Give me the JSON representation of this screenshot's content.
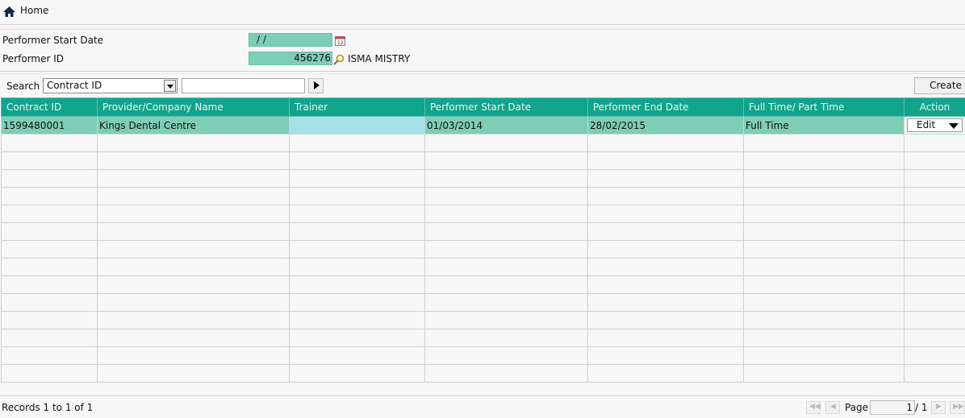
{
  "breadcrumb": {
    "home_label": "Home"
  },
  "form": {
    "start_date_label": "Performer Start Date",
    "start_date_value": "/ /",
    "performer_id_label": "Performer ID",
    "performer_id_value": "456276",
    "performer_name": "ISMA MISTRY"
  },
  "search": {
    "label": "Search",
    "field_selected": "Contract ID",
    "query": "",
    "create_label": "Create"
  },
  "table": {
    "columns": [
      "Contract ID",
      "Provider/Company Name",
      "Trainer",
      "Performer Start Date",
      "Performer End Date",
      "Full Time/ Part Time",
      "Action"
    ],
    "rows": [
      {
        "contract_id": "1599480001",
        "provider": "Kings Dental Centre",
        "trainer": "",
        "start_date": "01/03/2014",
        "end_date": "28/02/2015",
        "time_type": "Full Time",
        "action": "Edit"
      }
    ]
  },
  "footer": {
    "records_text": "Records 1 to 1 of 1",
    "page_label": "Page",
    "current_page": "1",
    "total_pages": "/ 1"
  },
  "colors": {
    "header_teal": "#12a38c",
    "selected_row": "#7ecdb7",
    "trainer_cell": "#a6e1e7"
  }
}
